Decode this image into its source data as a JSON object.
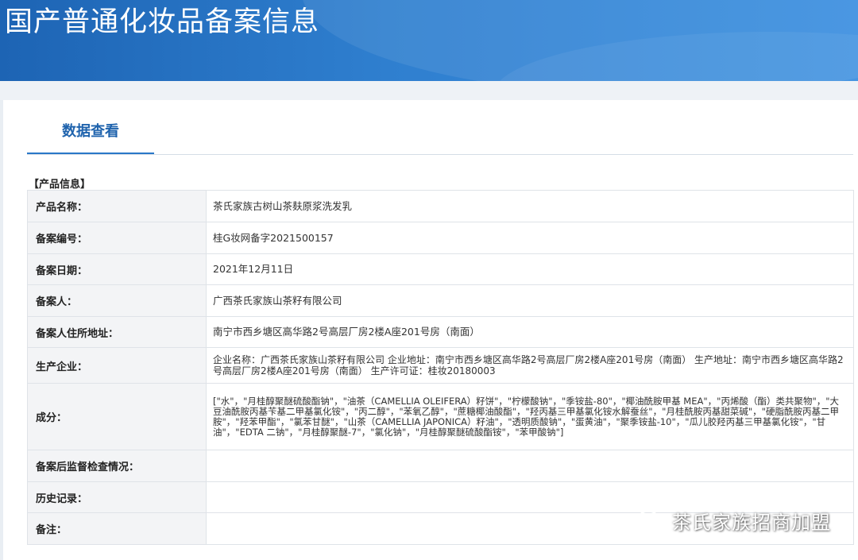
{
  "banner": {
    "title": "国产普通化妆品备案信息"
  },
  "tabs": [
    {
      "label": "数据查看"
    }
  ],
  "section": {
    "title": "【产品信息】"
  },
  "rows": [
    {
      "label": "产品名称：",
      "value": "茶氏家族古树山茶麸原浆洗发乳"
    },
    {
      "label": "备案编号：",
      "value": "桂G妆网备字2021500157"
    },
    {
      "label": "备案日期：",
      "value": "2021年12月11日"
    },
    {
      "label": "备案人：",
      "value": "广西茶氏家族山茶籽有限公司"
    },
    {
      "label": "备案人住所地址：",
      "value": "南宁市西乡塘区高华路2号高层厂房2楼A座201号房（南面）"
    },
    {
      "label": "生产企业：",
      "value": "企业名称：广西茶氏家族山茶籽有限公司 企业地址：南宁市西乡塘区高华路2号高层厂房2楼A座201号房（南面） 生产地址：南宁市西乡塘区高华路2号高层厂房2楼A座201号房（南面） 生产许可证：桂妆20180003"
    },
    {
      "label": "成分：",
      "value": "[\"水\"，\"月桂醇聚醚硫酸酯钠\"，\"油茶（CAMELLIA OLEIFERA）籽饼\"，\"柠檬酸钠\"，\"季铵盐-80\"，\"椰油酰胺甲基 MEA\"，\"丙烯酸（酯）类共聚物\"，\"大豆油酰胺丙基苄基二甲基氯化铵\"，\"丙二醇\"，\"苯氧乙醇\"，\"蔗糖椰油酸酯\"，\"羟丙基三甲基氯化铵水解蚕丝\"，\"月桂酰胺丙基甜菜碱\"，\"硬脂酰胺丙基二甲胺\"，\"羟苯甲酯\"，\"氯苯甘醚\"，\"山茶（CAMELLIA JAPONICA）籽油\"，\"透明质酸钠\"，\"蛋黄油\"，\"聚季铵盐-10\"，\"瓜儿胶羟丙基三甲基氯化铵\"，\"甘油\"，\"EDTA 二钠\"，\"月桂醇聚醚-7\"，\"氯化钠\"，\"月桂醇聚醚硫酸酯铵\"，\"苯甲酸钠\"]"
    },
    {
      "label": "备案后监督检查情况：",
      "value": ""
    },
    {
      "label": "历史记录：",
      "value": ""
    },
    {
      "label": "备注：",
      "value": ""
    }
  ],
  "watermark": {
    "text": "茶氏家族招商加盟",
    "icon": "wechat-icon"
  }
}
